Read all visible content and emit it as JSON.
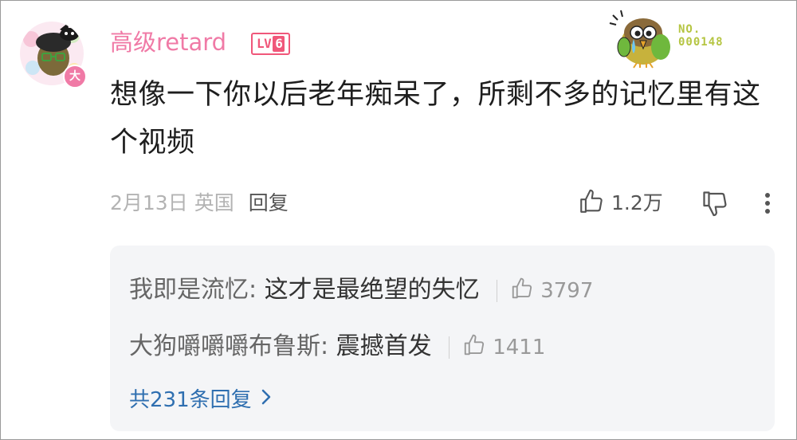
{
  "comment": {
    "username": "高级retard",
    "level": {
      "prefix": "LV",
      "number": "6"
    },
    "fan_badge_number": "NO.\n000148",
    "text": "想像一下你以后老年痴呆了，所剩不多的记忆里有这个视频",
    "date": "2月13日",
    "location": "英国",
    "reply_label": "回复",
    "likes": "1.2万",
    "avatar_badge": "大"
  },
  "replies": {
    "items": [
      {
        "author": "我即是流忆",
        "separator": ": ",
        "content": "这才是最绝望的失忆",
        "likes": "3797"
      },
      {
        "author": "大狗嚼嚼嚼布鲁斯",
        "separator": ": ",
        "content": "震撼首发",
        "likes": "1411"
      }
    ],
    "total_label": "共231条回复"
  },
  "colors": {
    "username": "#f07aa6",
    "level_badge": "#f0577a",
    "fan_badge_text": "#b5c542",
    "link": "#2f6fb0",
    "reply_bg": "#f4f5f7"
  },
  "icons": {
    "like": "thumbs-up-icon",
    "dislike": "thumbs-down-icon",
    "more": "more-vertical-icon",
    "chevron": "chevron-right-icon"
  }
}
